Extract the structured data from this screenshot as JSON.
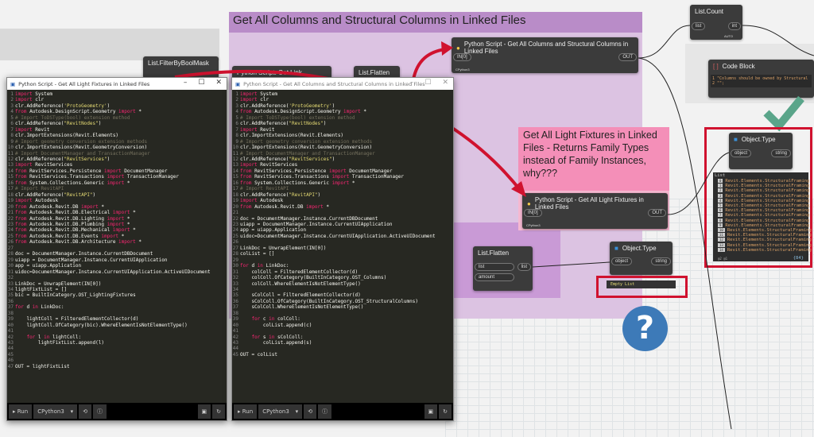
{
  "groups": {
    "columns_title": "Get All Columns and Structural Columns in Linked Files",
    "lights_title": "Get All Light Fixtures in Linked Files - Returns Family Types instead of Family Instances, why???"
  },
  "nodes": {
    "filter_mask": "List.FilterByBoolMask",
    "get_link_doc": "Python Script: Get Link Document",
    "flatten_top": "List.Flatten",
    "py_columns": "Python Script - Get All Columns and Structural Columns in Linked Files",
    "py_lights": "Python Script - Get All Light Fixtures in Linked Files",
    "in_port": "IN[0]",
    "out_port": "OUT",
    "engine": "CPython3",
    "list_count": "List.Count",
    "list_port": "list",
    "int_port": "int",
    "auto": "AUTO",
    "code_block": "Code Block",
    "code_block_lines": [
      "1 \"Columns should be owned by Structural",
      "2 \"\";"
    ],
    "object_type": "Object.Type",
    "object_port": "object",
    "string_port": "string",
    "flatten": "List.Flatten",
    "amount_port": "amount",
    "empty_list": "Empty List",
    "list_header": "List",
    "list_item": "Revit.Elements.StructuralFraming",
    "list_count_footer": "{84}",
    "list_levels": "@2 @1"
  },
  "left_window": {
    "title": "Python Script - Get All Light Fixtures in Linked Files",
    "lines": [
      "import System",
      "import clr",
      "clr.AddReference('ProtoGeometry')",
      "from Autodesk.DesignScript.Geometry import *",
      "# Import ToDSType(bool) extension method",
      "clr.AddReference(\"RevitNodes\")",
      "import Revit",
      "clr.ImportExtensions(Revit.Elements)",
      "# Import geometry conversion extension methods",
      "clr.ImportExtensions(Revit.GeometryConversion)",
      "# Import DocumentManager and TransactionManager",
      "clr.AddReference(\"RevitServices\")",
      "import RevitServices",
      "from RevitServices.Persistence import DocumentManager",
      "from RevitServices.Transactions import TransactionManager",
      "from System.Collections.Generic import *",
      "# Import RevitAPI",
      "clr.AddReference(\"RevitAPI\")",
      "import Autodesk",
      "from Autodesk.Revit.DB import *",
      "from Autodesk.Revit.DB.Electrical import *",
      "from Autodesk.Revit.DB.Lighting import *",
      "from Autodesk.Revit.DB.Plumbing import *",
      "from Autodesk.Revit.DB.Mechanical import *",
      "from Autodesk.Revit.DB.Events import *",
      "from Autodesk.Revit.DB.Architecture import *",
      "",
      "doc = DocumentManager.Instance.CurrentDBDocument",
      "uiapp = DocumentManager.Instance.CurrentUIApplication",
      "app = uiapp.Application",
      "uidoc=DocumentManager.Instance.CurrentUIApplication.ActiveUIDocument",
      "",
      "LinkDoc = UnwrapElement(IN[0])",
      "lightFixtList = []",
      "bic = BuiltInCategory.OST_LightingFixtures",
      "",
      "for d in LinkDoc:",
      "",
      "    lightColl = FilteredElementCollector(d)",
      "    lightColl.OfCategory(bic).WhereElementIsNotElementType()",
      "",
      "    for l in lightColl:",
      "        lightFixtList.append(l)",
      "",
      "",
      "",
      "OUT = lightFixtList"
    ]
  },
  "right_window": {
    "title": "Python Script - Get All Columns and Structural Columns in Linked Files",
    "lines": [
      "import System",
      "import clr",
      "clr.AddReference('ProtoGeometry')",
      "from Autodesk.DesignScript.Geometry import *",
      "# Import ToDSType(bool) extension method",
      "clr.AddReference(\"RevitNodes\")",
      "import Revit",
      "clr.ImportExtensions(Revit.Elements)",
      "# Import geometry conversion extension methods",
      "clr.ImportExtensions(Revit.GeometryConversion)",
      "# Import DocumentManager and TransactionManager",
      "clr.AddReference(\"RevitServices\")",
      "import RevitServices",
      "from RevitServices.Persistence import DocumentManager",
      "from RevitServices.Transactions import TransactionManager",
      "from System.Collections.Generic import *",
      "# Import RevitAPI",
      "clr.AddReference(\"RevitAPI\")",
      "import Autodesk",
      "from Autodesk.Revit.DB import *",
      "",
      "doc = DocumentManager.Instance.CurrentDBDocument",
      "uiapp = DocumentManager.Instance.CurrentUIApplication",
      "app = uiapp.Application",
      "uidoc=DocumentManager.Instance.CurrentUIApplication.ActiveUIDocument",
      "",
      "LinkDoc = UnwrapElement(IN[0])",
      "colList = []",
      "",
      "for d in LinkDoc:",
      "    colColl = FilteredElementCollector(d)",
      "    colColl.OfCategory(BuiltInCategory.OST_Columns)",
      "    colColl.WhereElementIsNotElementType()",
      "",
      "    sColColl = FilteredElementCollector(d)",
      "    sColColl.OfCategory(BuiltInCategory.OST_StructuralColumns)",
      "    sColColl.WhereElementIsNotElementType()",
      "",
      "    for c in colColl:",
      "        colList.append(c)",
      "",
      "    for s in sColColl:",
      "        colList.append(s)",
      "",
      "OUT = colList"
    ]
  },
  "toolbar": {
    "run": "Run",
    "engine": "CPython3"
  },
  "question_mark": "?",
  "colors": {
    "accent_red": "#d0122f",
    "purple_group": "#b98cc8",
    "pink_group": "#f48fb8",
    "check_green": "#5aa58a",
    "question_blue": "#3d7ab8"
  }
}
